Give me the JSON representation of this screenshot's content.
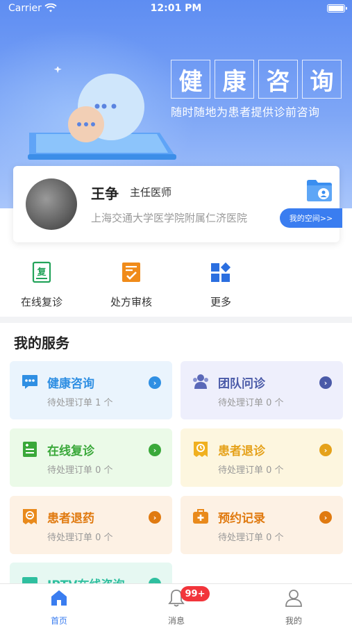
{
  "status_bar": {
    "carrier": "Carrier",
    "time": "12:01 PM"
  },
  "hero": {
    "title_chars": [
      "健",
      "康",
      "咨",
      "询"
    ],
    "subtitle": "随时随地为患者提供诊前咨询"
  },
  "profile": {
    "name": "王争",
    "title": "主任医师",
    "hospital": "上海交通大学医学院附属仁济医院",
    "space_button": "我的空间>>"
  },
  "quick_actions": [
    {
      "label": "在线复诊",
      "icon": "revisit-icon"
    },
    {
      "label": "处方审核",
      "icon": "prescription-review-icon"
    },
    {
      "label": "更多",
      "icon": "more-grid-icon"
    }
  ],
  "services": {
    "title": "我的服务",
    "items": [
      {
        "name": "健康咨询",
        "pending": "待处理订单 1 个",
        "color": "#2f8fe3",
        "bg": "#eaf4fd",
        "icon": "chat-icon"
      },
      {
        "name": "团队问诊",
        "pending": "待处理订单 0 个",
        "color": "#4a5aa8",
        "bg": "#eeeffc",
        "icon": "team-icon"
      },
      {
        "name": "在线复诊",
        "pending": "待处理订单 0 个",
        "color": "#3aa83a",
        "bg": "#ebfae8",
        "icon": "revisit-doc-icon"
      },
      {
        "name": "患者退诊",
        "pending": "待处理订单 0 个",
        "color": "#e5a11a",
        "bg": "#fdf6df",
        "icon": "refund-visit-icon"
      },
      {
        "name": "患者退药",
        "pending": "待处理订单 0 个",
        "color": "#e07a10",
        "bg": "#fdf1e4",
        "icon": "refund-drug-icon"
      },
      {
        "name": "预约记录",
        "pending": "待处理订单 0 个",
        "color": "#e07a10",
        "bg": "#fdf1e4",
        "icon": "appointment-icon"
      },
      {
        "name": "IPTV在线咨询",
        "pending": "",
        "color": "#2fbf9f",
        "bg": "#e6f8f2",
        "icon": "iptv-icon"
      }
    ]
  },
  "tabbar": {
    "tabs": [
      {
        "label": "首页",
        "icon": "home-icon"
      },
      {
        "label": "消息",
        "icon": "bell-icon"
      },
      {
        "label": "我的",
        "icon": "user-icon"
      }
    ],
    "message_badge": "99+"
  }
}
